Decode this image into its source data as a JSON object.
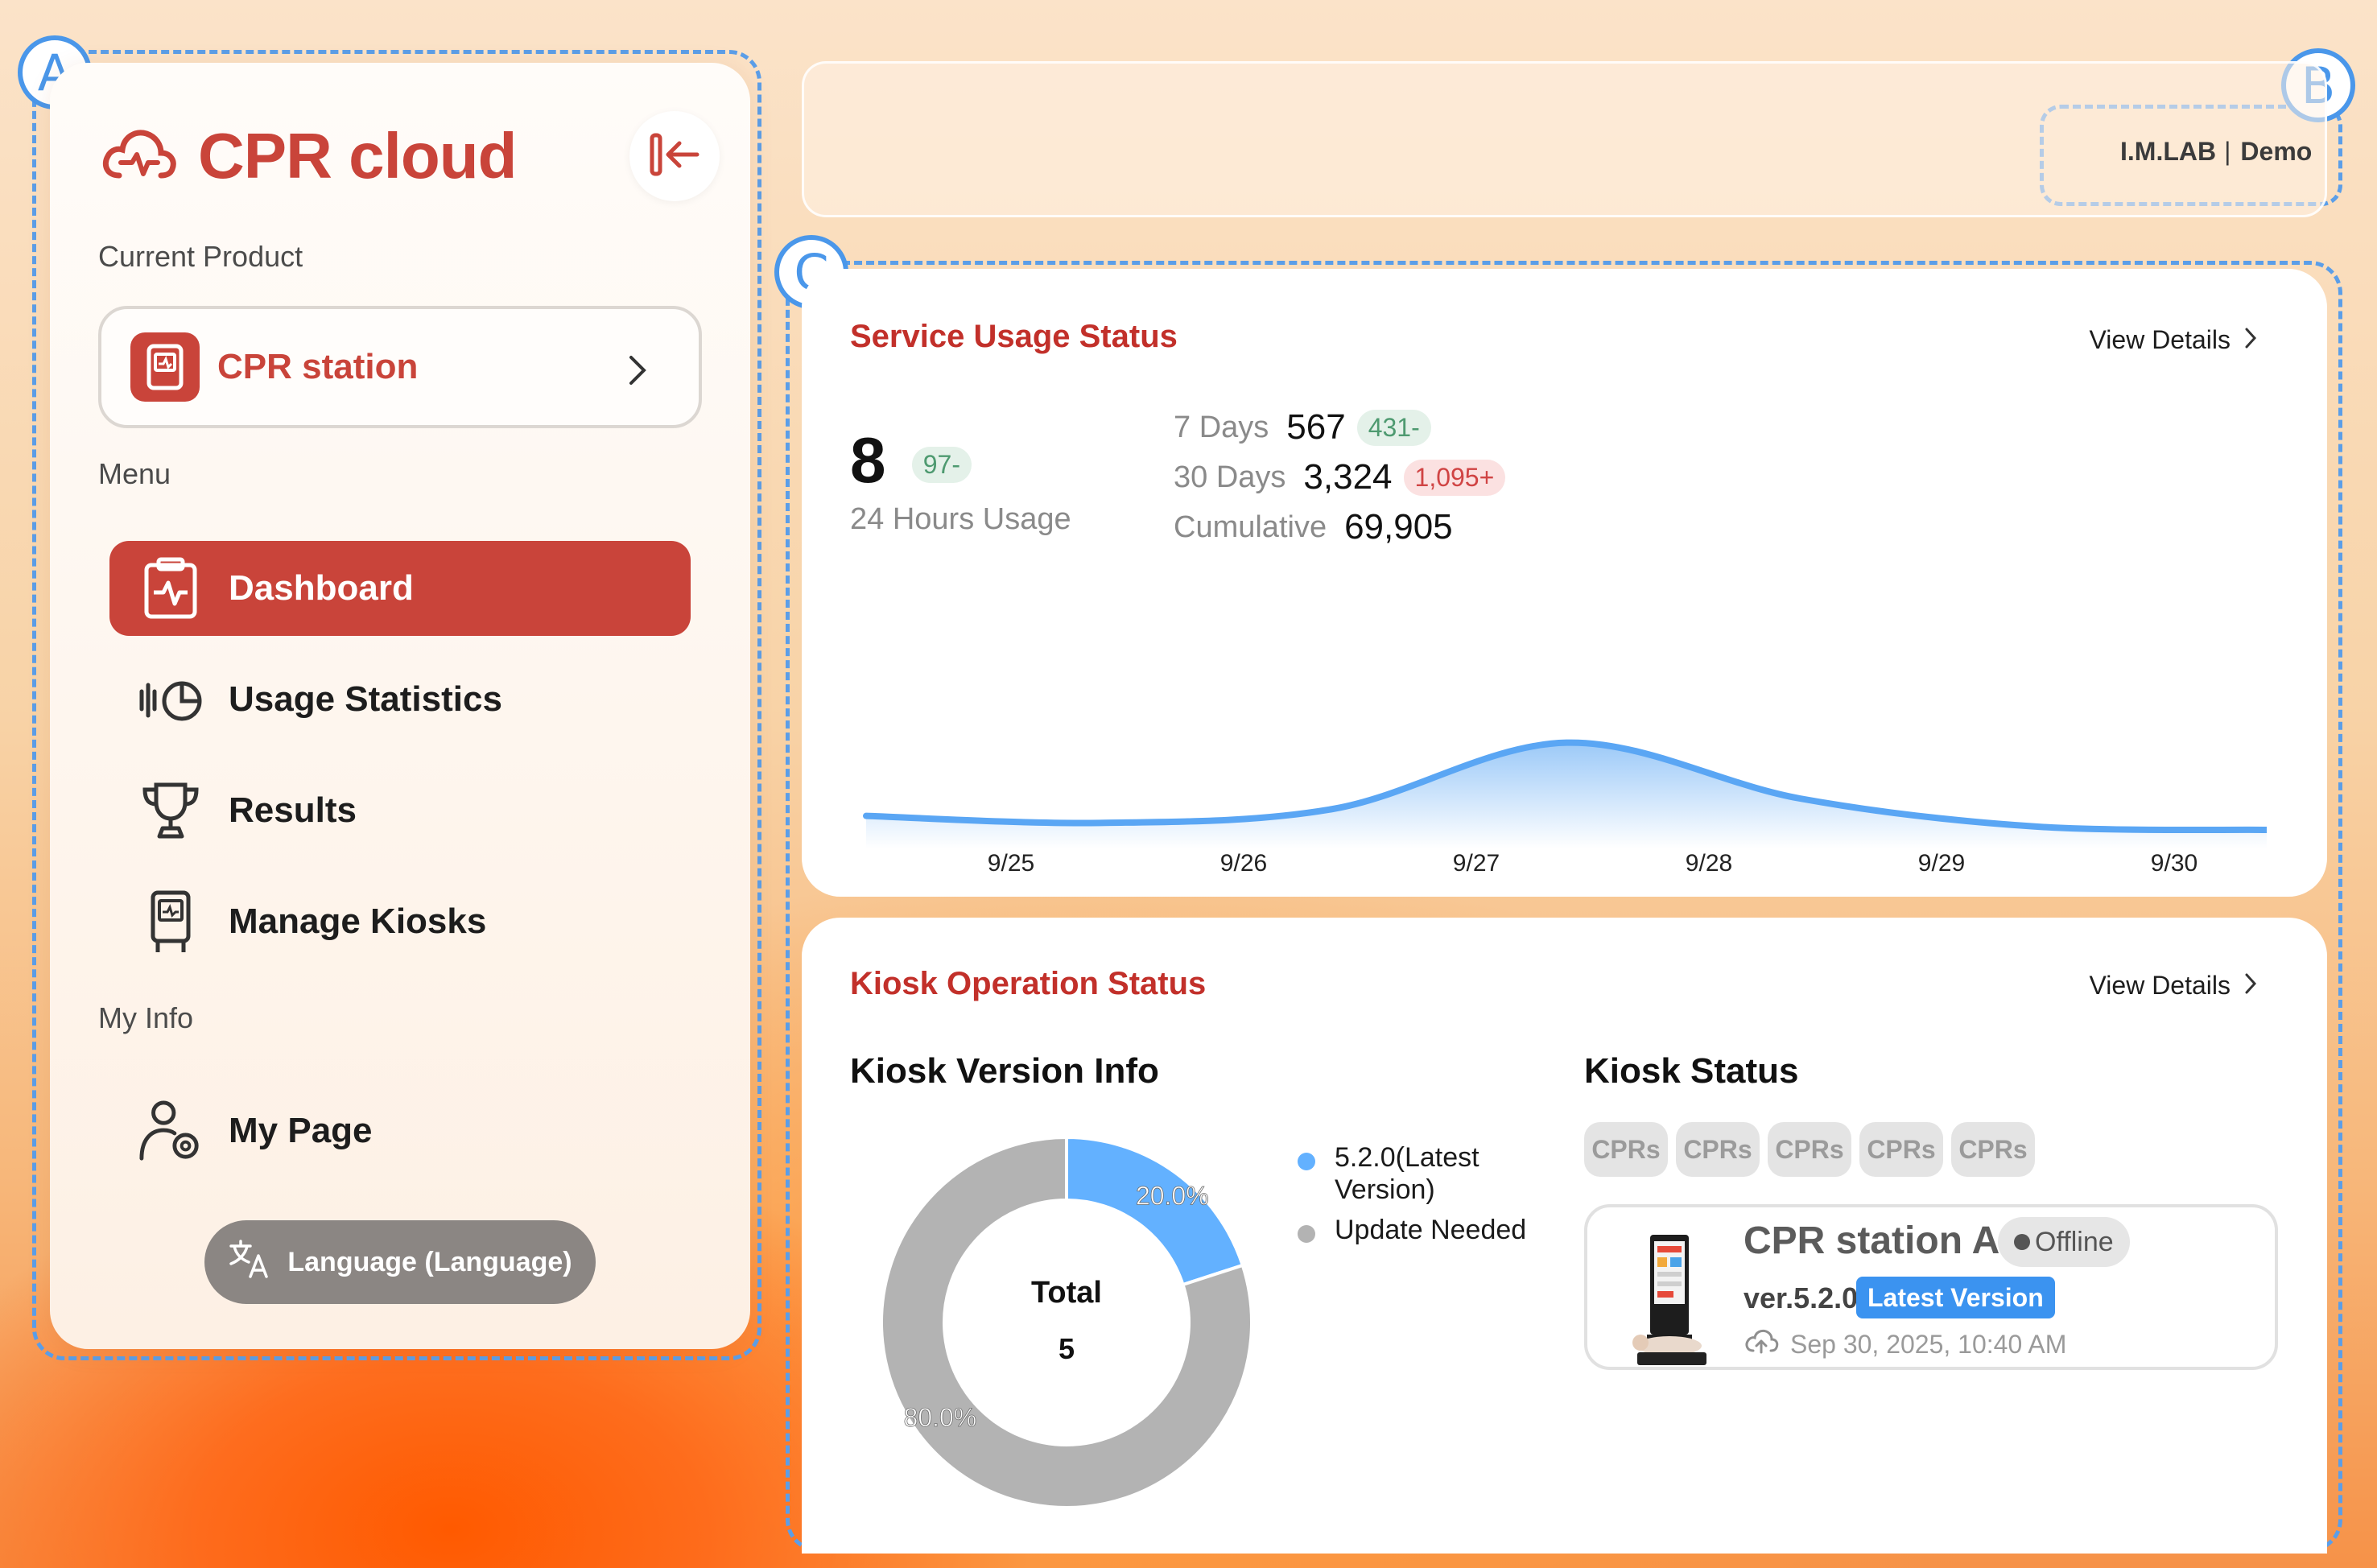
{
  "annotations": {
    "a": "A",
    "b": "B",
    "c": "C"
  },
  "sidebar": {
    "logo_text": "CPR cloud",
    "current_product_label": "Current Product",
    "product_name": "CPR station",
    "menu_label": "Menu",
    "items": [
      {
        "label": "Dashboard",
        "icon": "dashboard-icon",
        "active": true
      },
      {
        "label": "Usage Statistics",
        "icon": "usage-statistics-icon",
        "active": false
      },
      {
        "label": "Results",
        "icon": "trophy-icon",
        "active": false
      },
      {
        "label": "Manage Kiosks",
        "icon": "kiosk-icon",
        "active": false
      }
    ],
    "myinfo_label": "My Info",
    "mypage_label": "My Page",
    "language_label": "Language (Language)"
  },
  "header": {
    "org": "I.M.LAB",
    "user": "Demo"
  },
  "usage": {
    "title": "Service Usage Status",
    "view_details": "View Details",
    "hours_value": "8",
    "hours_delta": "97-",
    "hours_label": "24 Hours Usage",
    "stats": [
      {
        "key": "7 Days",
        "value": "567",
        "delta": "431-",
        "trend": "down"
      },
      {
        "key": "30 Days",
        "value": "3,324",
        "delta": "1,095+",
        "trend": "up"
      },
      {
        "key": "Cumulative",
        "value": "69,905",
        "delta": "",
        "trend": "none"
      }
    ]
  },
  "kiosk": {
    "title": "Kiosk Operation Status",
    "view_details": "View Details",
    "version_title": "Kiosk Version Info",
    "total_label": "Total",
    "total_value": "5",
    "status_title": "Kiosk Status",
    "tags": [
      "CPRs",
      "CPRs",
      "CPRs",
      "CPRs",
      "CPRs"
    ],
    "legend": [
      {
        "label": "5.2.0(Latest Version)",
        "color": "#63b1ff"
      },
      {
        "label": "Update Needed",
        "color": "#b3b3b3"
      }
    ],
    "device": {
      "name": "CPR station A",
      "status": "Offline",
      "version": "ver.5.2.0",
      "version_badge": "Latest Version",
      "last_sync": "Sep 30, 2025, 10:40 AM"
    }
  },
  "colors": {
    "accent": "#c9443a",
    "title_red": "#c2302a",
    "blue": "#4a97ea"
  },
  "chart_data": [
    {
      "type": "area",
      "x": [
        "9/25",
        "9/26",
        "9/27",
        "9/28",
        "9/29",
        "9/30"
      ],
      "series": [
        {
          "values": [
            7,
            5,
            9,
            28,
            12,
            4,
            3
          ]
        }
      ],
      "grid": false,
      "legend": "none"
    },
    {
      "type": "pie",
      "categories": [
        "5.2.0(Latest Version)",
        "Update Needed"
      ],
      "values": [
        20.0,
        80.0
      ],
      "labels": [
        "20.0%",
        "80.0%"
      ],
      "legend": "right"
    }
  ]
}
